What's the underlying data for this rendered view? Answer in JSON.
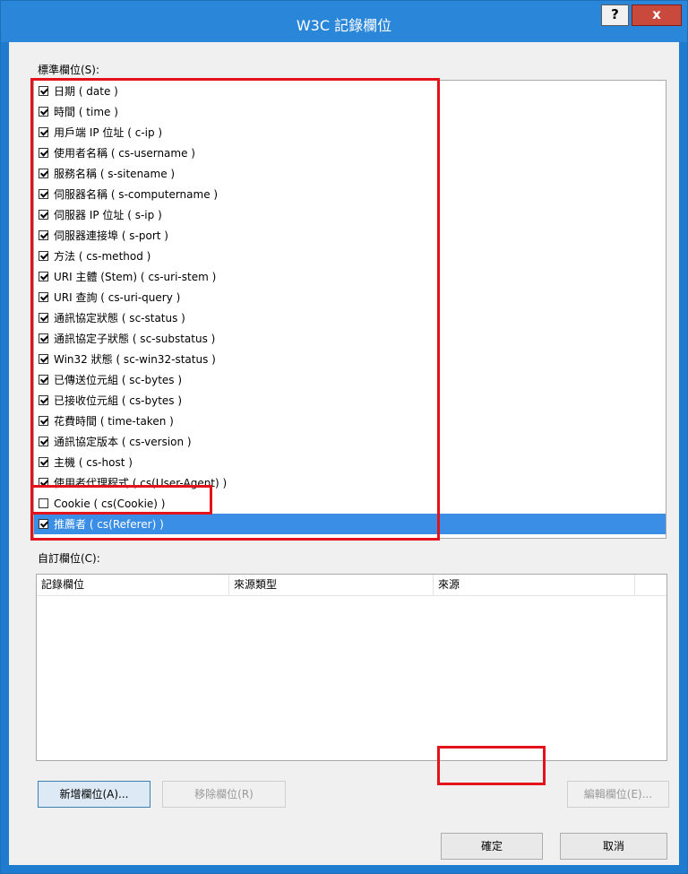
{
  "window": {
    "title": "W3C 記錄欄位",
    "help_label": "?",
    "close_label": "x"
  },
  "standard_fields": {
    "label": "標準欄位(S):",
    "items": [
      {
        "label": "日期 ( date )",
        "checked": true
      },
      {
        "label": "時間 ( time )",
        "checked": true
      },
      {
        "label": "用戶端 IP 位址 ( c-ip )",
        "checked": true
      },
      {
        "label": "使用者名稱 ( cs-username )",
        "checked": true
      },
      {
        "label": "服務名稱 ( s-sitename )",
        "checked": true
      },
      {
        "label": "伺服器名稱 ( s-computername )",
        "checked": true
      },
      {
        "label": "伺服器 IP 位址 ( s-ip )",
        "checked": true
      },
      {
        "label": "伺服器連接埠 ( s-port )",
        "checked": true
      },
      {
        "label": "方法 ( cs-method )",
        "checked": true
      },
      {
        "label": "URI 主體 (Stem) ( cs-uri-stem )",
        "checked": true
      },
      {
        "label": "URI 查詢 ( cs-uri-query )",
        "checked": true
      },
      {
        "label": "通訊協定狀態 ( sc-status )",
        "checked": true
      },
      {
        "label": "通訊協定子狀態 ( sc-substatus )",
        "checked": true
      },
      {
        "label": "Win32 狀態 ( sc-win32-status )",
        "checked": true
      },
      {
        "label": "已傳送位元組 ( sc-bytes )",
        "checked": true
      },
      {
        "label": "已接收位元組 ( cs-bytes )",
        "checked": true
      },
      {
        "label": "花費時間 ( time-taken )",
        "checked": true
      },
      {
        "label": "通訊協定版本 ( cs-version )",
        "checked": true
      },
      {
        "label": "主機 ( cs-host )",
        "checked": true
      },
      {
        "label": "使用者代理程式 ( cs(User-Agent) )",
        "checked": true
      },
      {
        "label": "Cookie ( cs(Cookie) )",
        "checked": false
      },
      {
        "label": "推薦者 ( cs(Referer) )",
        "checked": true,
        "selected": true
      }
    ]
  },
  "custom_fields": {
    "label": "自訂欄位(C):",
    "columns": [
      "記錄欄位",
      "來源類型",
      "來源"
    ]
  },
  "buttons": {
    "add": "新增欄位(A)...",
    "remove": "移除欄位(R)",
    "edit": "編輯欄位(E)...",
    "ok": "確定",
    "cancel": "取消"
  },
  "colors": {
    "accent": "#2a86d8",
    "selection": "#3a8ee6",
    "annotation": "#e3131b"
  }
}
